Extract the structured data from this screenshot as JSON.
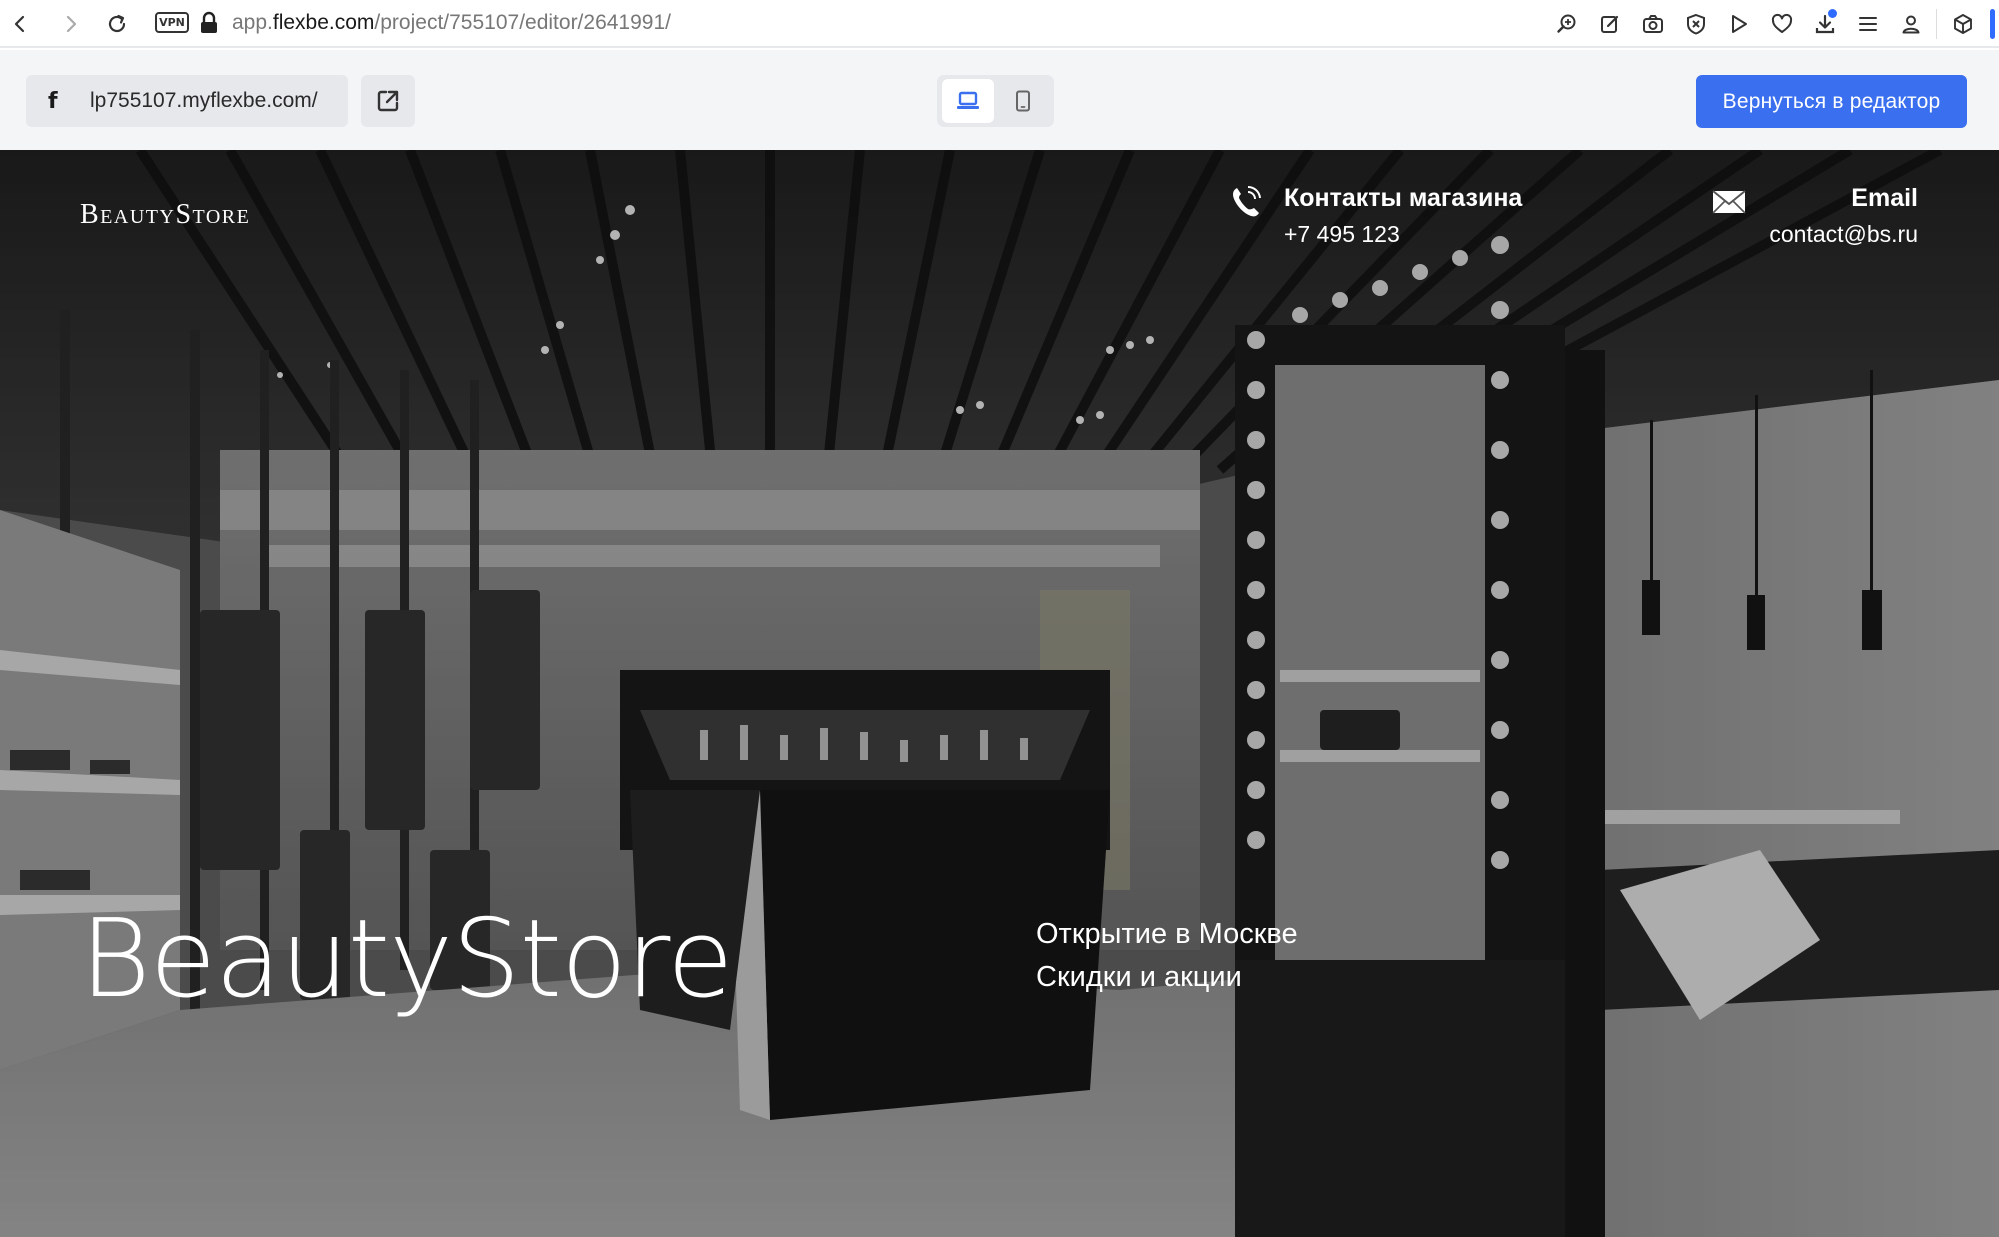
{
  "browser": {
    "url_prefix": "app.",
    "url_domain": "flexbe.com",
    "url_path": "/project/755107/editor/2641991/",
    "vpn_label": "VPN"
  },
  "toolbar": {
    "site_url": "lp755107.myflexbe.com/",
    "site_icon": "flexbe-f-icon",
    "site_icon_glyph": "f",
    "back_button_label": "Вернуться в редактор",
    "accent_color": "#3a6fef"
  },
  "hero": {
    "logo": "BeautyStore",
    "phone_title": "Контакты магазина",
    "phone_value": "+7 495 123",
    "email_title": "Email",
    "email_value": "contact@bs.ru",
    "title": "BeautyStore",
    "line1": "Открытие в Москве",
    "line2": "Скидки и акции"
  }
}
